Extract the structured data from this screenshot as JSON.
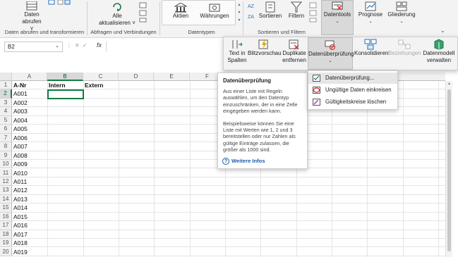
{
  "ribbon": {
    "groups": [
      {
        "label": "Daten abrufen und transformieren"
      },
      {
        "label": "Abfragen und Verbindungen"
      },
      {
        "label": "Datentypen"
      },
      {
        "label": "Sortieren und Filtern"
      }
    ],
    "buttons": {
      "daten_abrufen_1": "Daten",
      "daten_abrufen_2": "abrufen ˅",
      "alle_aktualisieren_1": "Alle",
      "alle_aktualisieren_2": "aktualisieren ˅",
      "aktien": "Aktien",
      "waehrungen": "Währungen",
      "sortieren": "Sortieren",
      "filtern": "Filtern",
      "datentools": "Datentools",
      "prognose": "Prognose",
      "gliederung": "Gliederung"
    }
  },
  "formula_bar": {
    "name_box": "B2",
    "fx": "fx"
  },
  "tools_popup": {
    "text_in_spalten_1": "Text in",
    "text_in_spalten_2": "Spalten",
    "blitzvorschau": "Blitzvorschau",
    "duplikate_1": "Duplikate",
    "duplikate_2": "entfernen",
    "datenueberpruefung": "Datenüberprüfung",
    "konsolidieren": "Konsolidieren",
    "beziehungen": "Beziehungen",
    "datenmodell_1": "Datenmodell",
    "datenmodell_2": "verwalten"
  },
  "tooltip": {
    "title": "Datenüberprüfung",
    "para1": "Aus einer Liste mit Regeln auswählen, um den Datentyp einzuschränken, der in eine Zelle eingegeben werden kann.",
    "para2": "Beispielsweise können Sie eine Liste mit Werten wie 1, 2 und 3 bereitstellen oder nur Zahlen als gültige Einträge zulassen, die größer als 1000 sind.",
    "more": "Weitere Infos"
  },
  "menu": {
    "items": [
      "Datenüberprüfung...",
      "Ungültige Daten einkreisen",
      "Gültigkeitskreise löschen"
    ]
  },
  "sheet": {
    "columns": [
      "A",
      "B",
      "C",
      "D",
      "E",
      "F"
    ],
    "rows": [
      "1",
      "2",
      "3",
      "4",
      "5",
      "6",
      "7",
      "8",
      "9",
      "10",
      "11",
      "12",
      "13",
      "14",
      "15",
      "16",
      "17",
      "18",
      "19",
      "20"
    ],
    "colA": [
      "A-Nr",
      "A001",
      "A002",
      "A003",
      "A004",
      "A005",
      "A006",
      "A007",
      "A008",
      "A009",
      "A010",
      "A011",
      "A012",
      "A013",
      "A014",
      "A015",
      "A016",
      "A017",
      "A018",
      "A019"
    ],
    "b1": "Intern",
    "c1": "Extern"
  },
  "colors": {
    "accent": "#217346",
    "selection": "#107c41"
  }
}
